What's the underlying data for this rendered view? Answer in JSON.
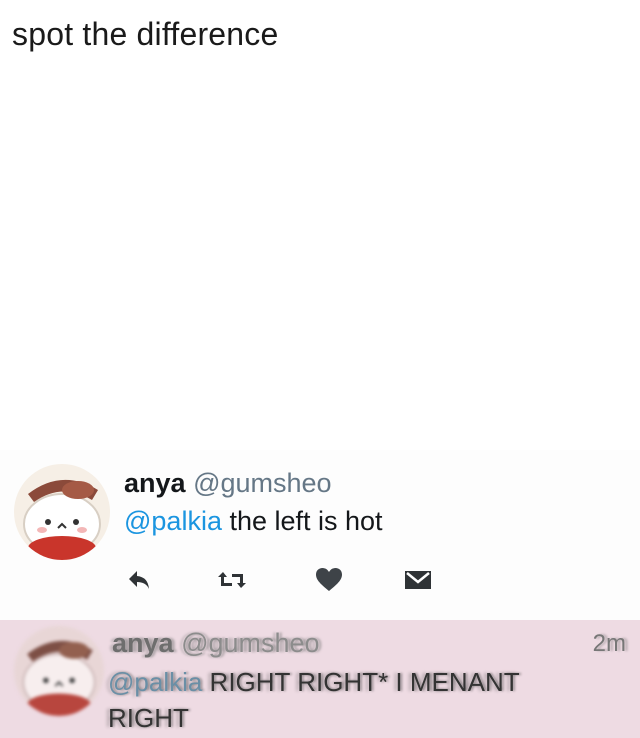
{
  "caption": "spot the difference",
  "tweet_top": {
    "avatar": "bunny-with-hat-avatar",
    "display_name": "anya",
    "handle": "@gumsheo",
    "mention": "@palkia",
    "text": " the left is hot",
    "actions": [
      {
        "icon": "reply-icon"
      },
      {
        "icon": "retweet-icon"
      },
      {
        "icon": "heart-icon"
      },
      {
        "icon": "message-icon"
      }
    ]
  },
  "tweet_bottom": {
    "avatar": "bunny-with-hat-avatar",
    "display_name": "anya",
    "handle": "@gumsheo",
    "time": "2m",
    "mention": "@palkia",
    "text": " RIGHT RIGHT* I MENANT RIGHT",
    "background": "#eedbe3"
  },
  "colors": {
    "link_blue": "#1b95e0",
    "icon_gray": "#657786",
    "heart_dark": "#4a4f55"
  }
}
